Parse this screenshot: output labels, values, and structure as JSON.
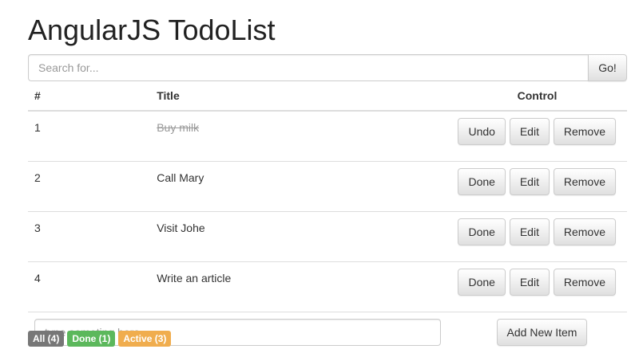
{
  "app": {
    "title": "AngularJS TodoList"
  },
  "search": {
    "placeholder": "Search for...",
    "value": "",
    "button_label": "Go!"
  },
  "table": {
    "headers": {
      "num": "#",
      "title": "Title",
      "control": "Control"
    },
    "rows": [
      {
        "num": "1",
        "title": "Buy milk",
        "done": true,
        "toggle_label": "Undo",
        "edit_label": "Edit",
        "remove_label": "Remove"
      },
      {
        "num": "2",
        "title": "Call Mary",
        "done": false,
        "toggle_label": "Done",
        "edit_label": "Edit",
        "remove_label": "Remove"
      },
      {
        "num": "3",
        "title": "Visit Johe",
        "done": false,
        "toggle_label": "Done",
        "edit_label": "Edit",
        "remove_label": "Remove"
      },
      {
        "num": "4",
        "title": "Write an article",
        "done": false,
        "toggle_label": "Done",
        "edit_label": "Edit",
        "remove_label": "Remove"
      }
    ]
  },
  "new_item": {
    "placeholder": "type someting here...",
    "value": "",
    "button_label": "Add New Item"
  },
  "filters": [
    {
      "label": "All (4)",
      "color": "#777777"
    },
    {
      "label": "Done (1)",
      "color": "#5cb85c"
    },
    {
      "label": "Active (3)",
      "color": "#f0ad4e"
    }
  ]
}
